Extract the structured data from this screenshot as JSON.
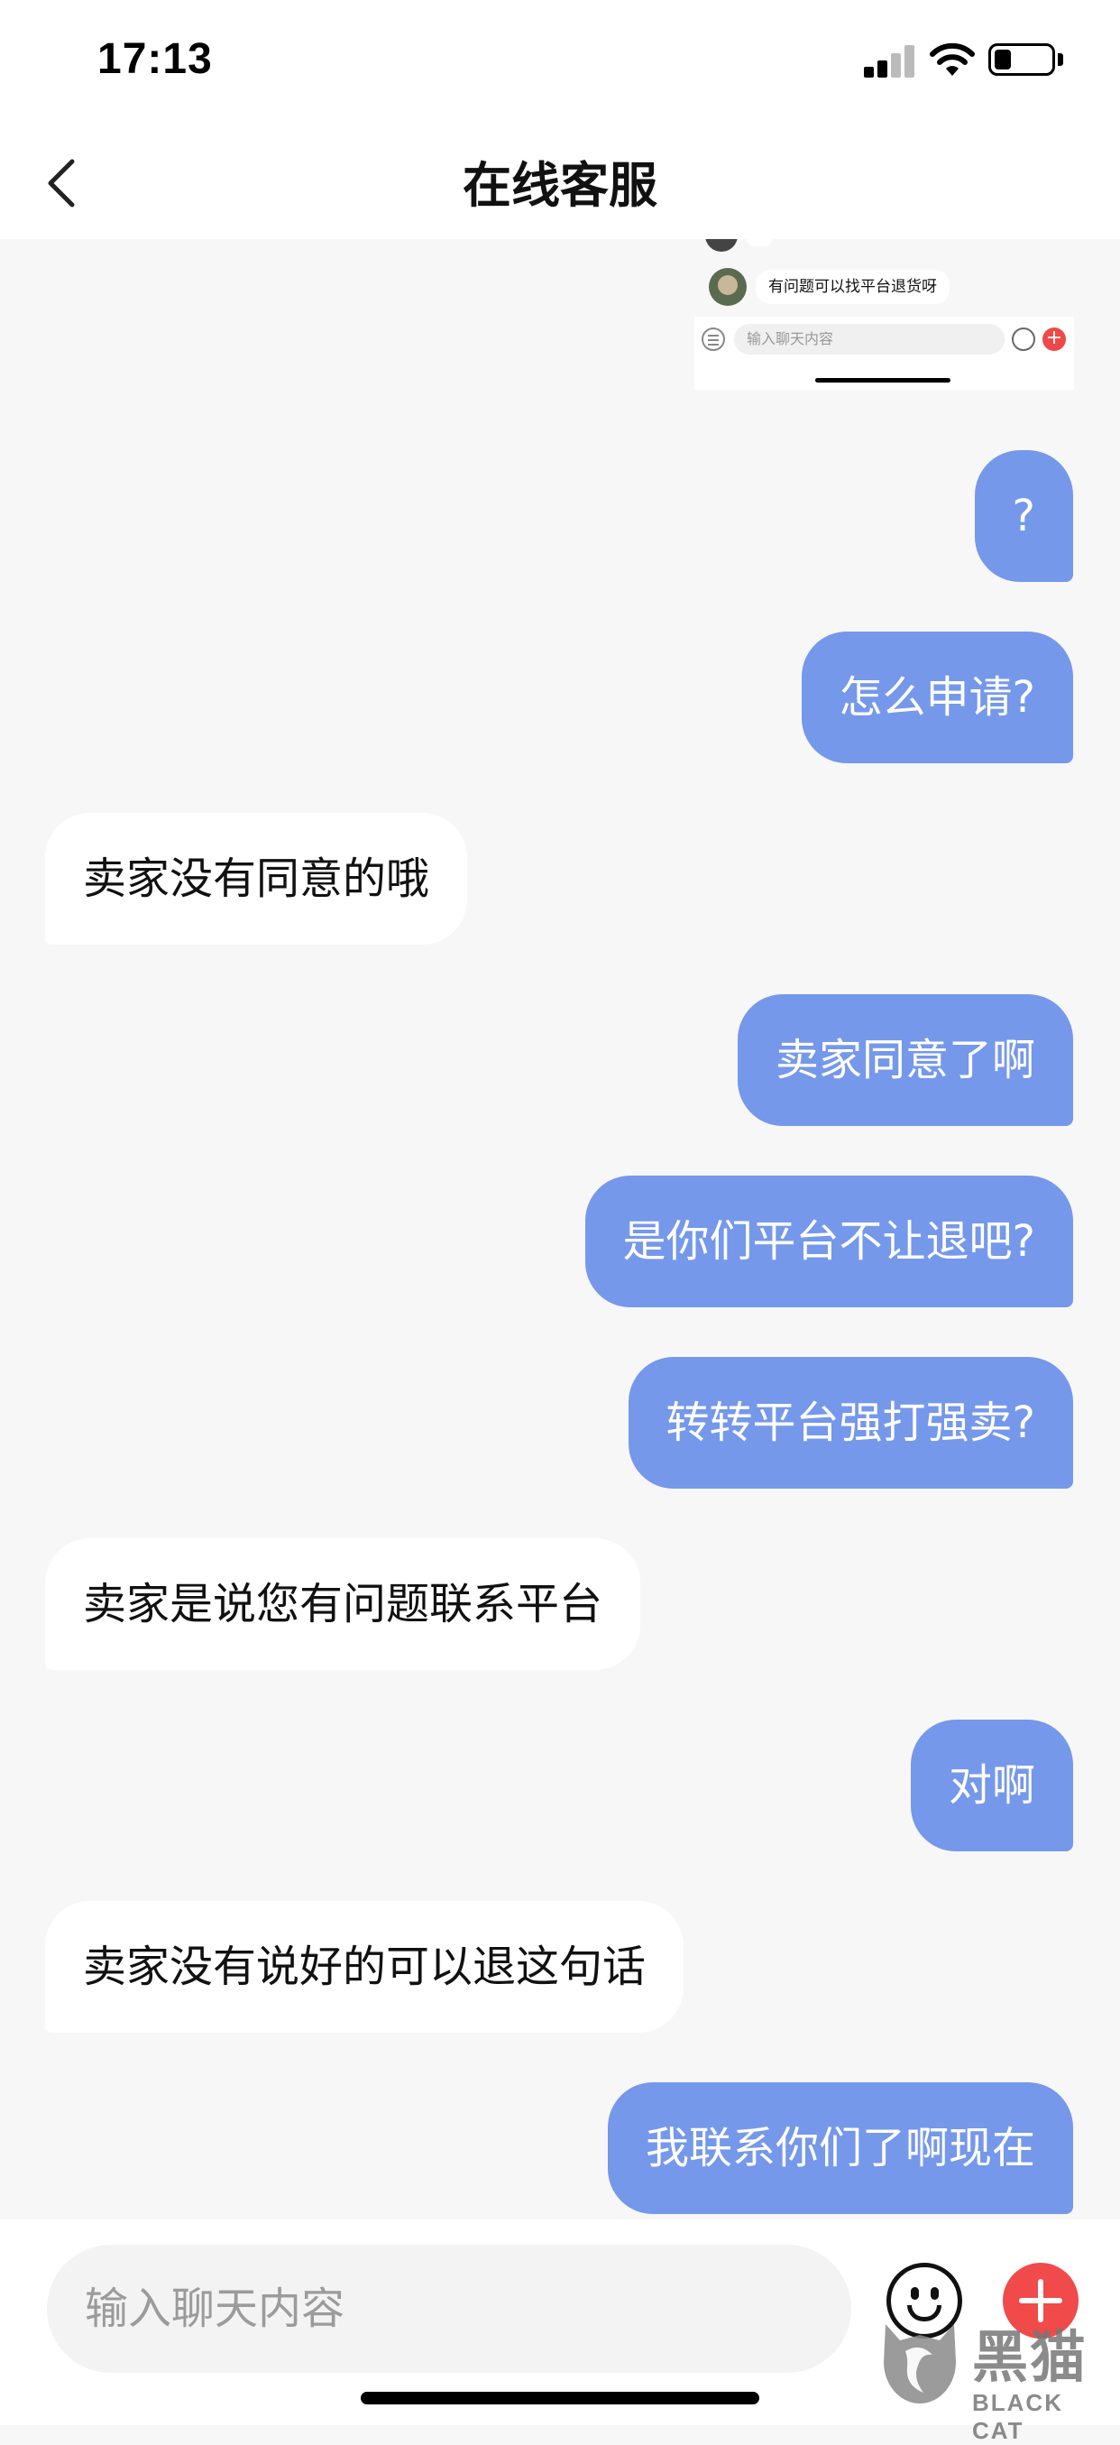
{
  "status_bar": {
    "time": "17:13"
  },
  "header": {
    "title": "在线客服"
  },
  "embedded_screenshot": {
    "message": "有问题可以找平台退货呀",
    "input_placeholder": "输入聊天内容",
    "plus_symbol": "+"
  },
  "messages": [
    {
      "from": "me",
      "text": "?"
    },
    {
      "from": "me",
      "text": "怎么申请?"
    },
    {
      "from": "them",
      "text": "卖家没有同意的哦"
    },
    {
      "from": "me",
      "text": "卖家同意了啊"
    },
    {
      "from": "me",
      "text": "是你们平台不让退吧?"
    },
    {
      "from": "me",
      "text": "转转平台强打强卖?"
    },
    {
      "from": "them",
      "text": "卖家是说您有问题联系平台"
    },
    {
      "from": "me",
      "text": "对啊"
    },
    {
      "from": "them",
      "text": "卖家没有说好的可以退这句话"
    },
    {
      "from": "me",
      "text": "我联系你们了啊现在"
    }
  ],
  "input": {
    "placeholder": "输入聊天内容"
  },
  "watermark": {
    "text_cn": "黑猫",
    "text_en": "BLACK CAT"
  },
  "colors": {
    "my_bubble": "#7598ea",
    "their_bubble": "#ffffff",
    "background": "#f7f7f7",
    "plus_button": "#f04a4a"
  }
}
